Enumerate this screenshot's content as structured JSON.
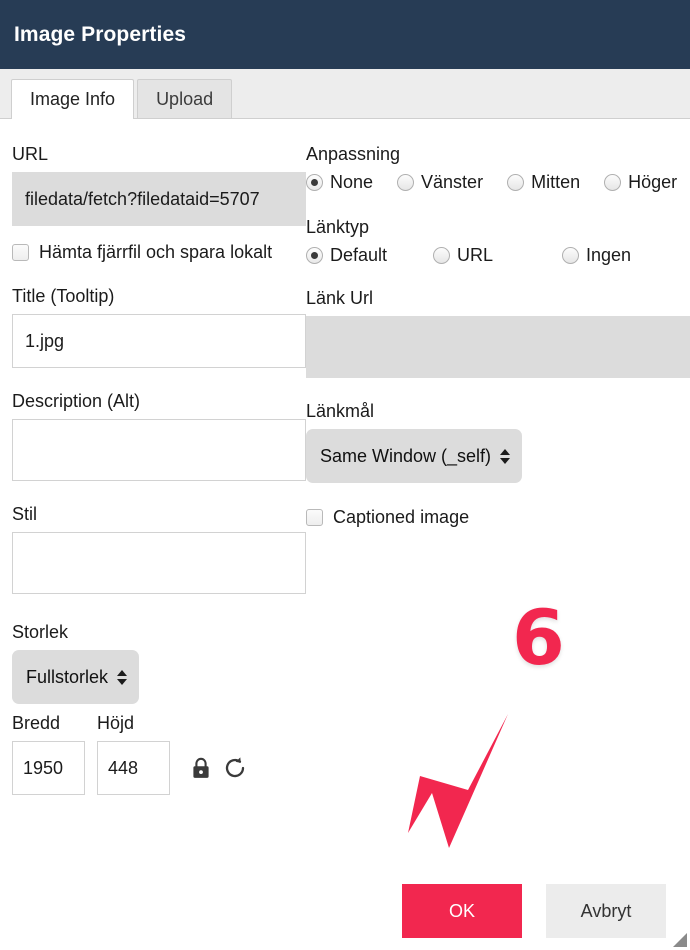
{
  "header": {
    "title": "Image Properties"
  },
  "tabs": [
    {
      "label": "Image Info",
      "active": true
    },
    {
      "label": "Upload",
      "active": false
    }
  ],
  "left_column": {
    "url": {
      "label": "URL",
      "value": "filedata/fetch?filedataid=5707",
      "placeholder": "",
      "disabled": true
    },
    "fetch_remote": {
      "label": "Hämta fjärrfil och spara lokalt",
      "checked": false
    },
    "title_tooltip": {
      "label": "Title (Tooltip)",
      "value": "1.jpg",
      "placeholder": ""
    },
    "description_alt": {
      "label": "Description (Alt)",
      "value": "",
      "placeholder": ""
    },
    "stil": {
      "label": "Stil",
      "value": "",
      "placeholder": ""
    },
    "storlek": {
      "label": "Storlek",
      "selected": "Fullstorlek",
      "options": [
        "Fullstorlek"
      ]
    },
    "bredd": {
      "label": "Bredd",
      "value": "1950"
    },
    "hojd": {
      "label": "Höjd",
      "value": "448"
    },
    "lock_icon_name": "lock-icon",
    "reset_icon_name": "reset-icon"
  },
  "right_column": {
    "anpassning": {
      "label": "Anpassning",
      "options": [
        {
          "label": "None",
          "checked": true
        },
        {
          "label": "Vänster",
          "checked": false
        },
        {
          "label": "Mitten",
          "checked": false
        },
        {
          "label": "Höger",
          "checked": false
        }
      ]
    },
    "lanktyp": {
      "label": "Länktyp",
      "options": [
        {
          "label": "Default",
          "checked": true
        },
        {
          "label": "URL",
          "checked": false
        },
        {
          "label": "Ingen",
          "checked": false
        }
      ]
    },
    "lank_url": {
      "label": "Länk Url",
      "value": "",
      "placeholder": "",
      "disabled": true
    },
    "lankmal": {
      "label": "Länkmål",
      "selected": "Same Window (_self)",
      "options": [
        "Same Window (_self)"
      ]
    },
    "captioned_image": {
      "label": "Captioned image",
      "checked": false
    }
  },
  "footer": {
    "ok_label": "OK",
    "cancel_label": "Avbryt"
  },
  "annotation": {
    "step_number": "6",
    "arrow_color": "#F2274F",
    "badge_color": "#F2274F"
  },
  "colors": {
    "header_bg": "#273C55",
    "ok_button": "#F2274F",
    "cancel_button": "#ececec",
    "disabled_field": "#dcdcdc",
    "tab_bar": "#ededed"
  }
}
